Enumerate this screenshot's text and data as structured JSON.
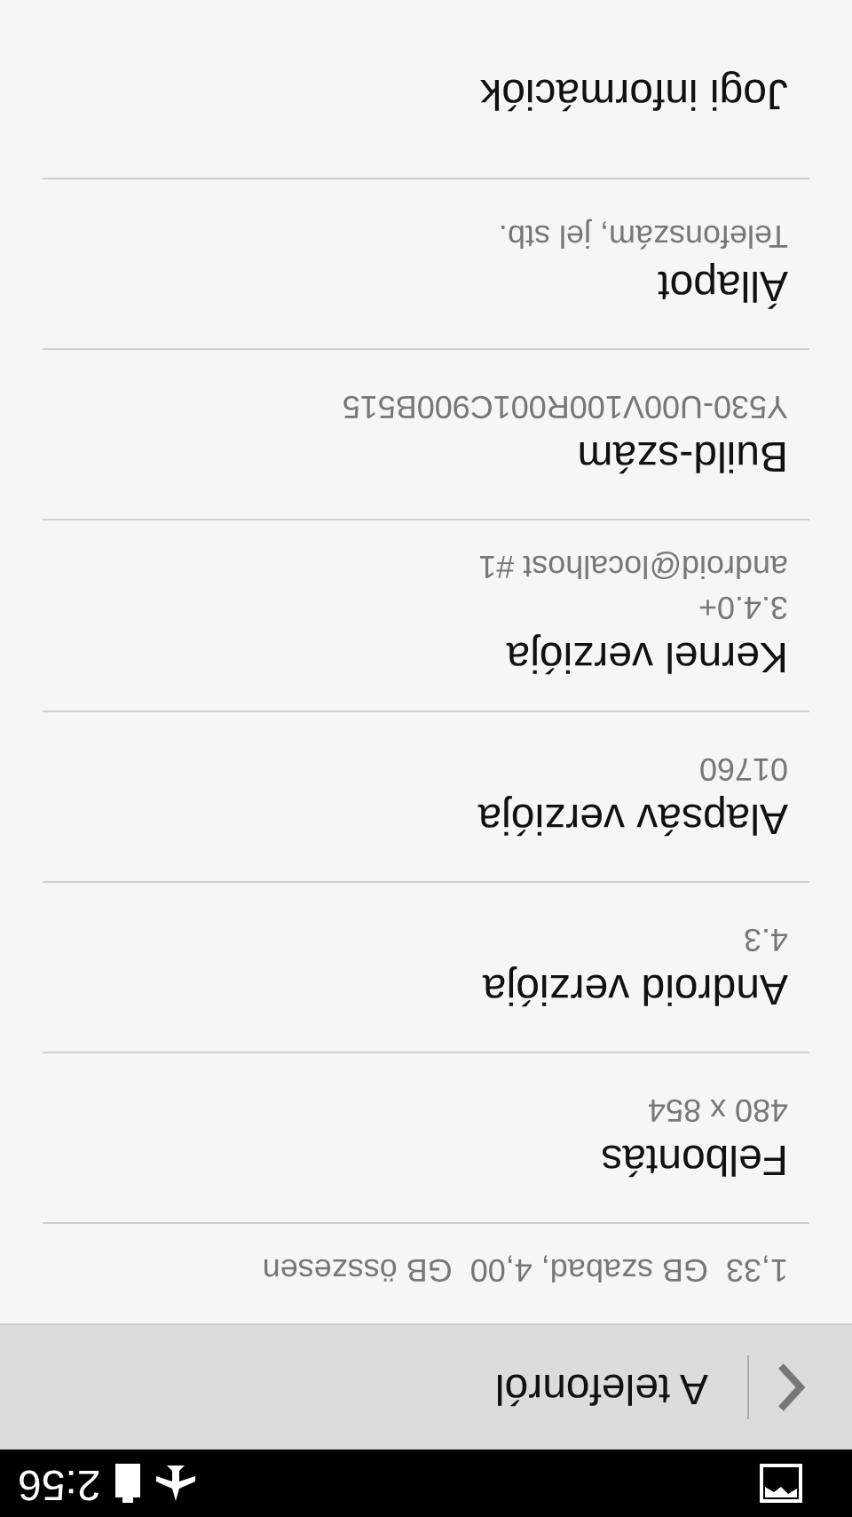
{
  "status_bar": {
    "time": "2:56"
  },
  "action_bar": {
    "title": "A telefonról"
  },
  "items": [
    {
      "summary": [
        "1,33  GB szabad, 4,00  GB összesen"
      ]
    },
    {
      "title": "Felbontás",
      "summary": [
        "480 x 854"
      ]
    },
    {
      "title": "Android verziója",
      "summary": [
        "4.3"
      ]
    },
    {
      "title": "Alapsáv verziója",
      "summary": [
        "01760"
      ]
    },
    {
      "title": "Kernel verziója",
      "summary": [
        "3.4.0+",
        "android@localhost #1"
      ]
    },
    {
      "title": "Build-szám",
      "summary": [
        "Y530-U00V100R001C900B515"
      ]
    },
    {
      "title": "Állapot",
      "summary": [
        "Telefonszám, jel stb."
      ]
    },
    {
      "title": "Jogi információk"
    }
  ]
}
